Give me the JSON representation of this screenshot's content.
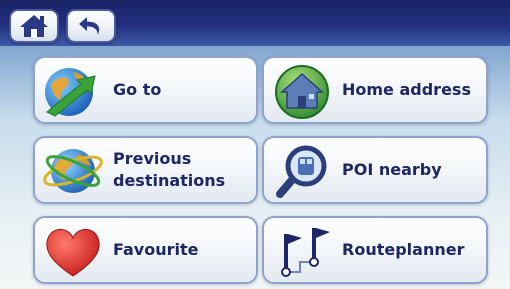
{
  "toolbar": {
    "home_icon": "home-icon",
    "back_icon": "back-arrow-icon"
  },
  "menu": {
    "goto": {
      "label": "Go to",
      "icon": "globe-arrow-icon"
    },
    "home_address": {
      "label": "Home address",
      "icon": "house-icon"
    },
    "previous": {
      "label": "Previous\ndestinations",
      "icon": "globe-orbit-icon"
    },
    "poi": {
      "label": "POI nearby",
      "icon": "magnifier-icon"
    },
    "favourite": {
      "label": "Favourite",
      "icon": "heart-icon"
    },
    "routeplanner": {
      "label": "Routeplanner",
      "icon": "route-flags-icon"
    }
  },
  "colors": {
    "header": "#22307e",
    "label": "#1d2766",
    "button_border": "#8ea4cd"
  }
}
